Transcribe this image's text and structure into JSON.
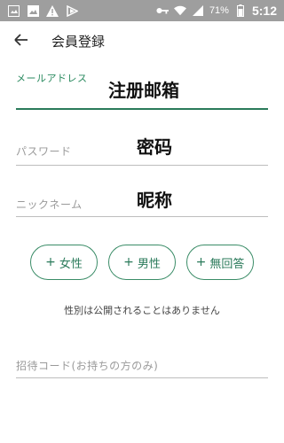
{
  "status_bar": {
    "battery_percent": "71%",
    "time": "5:12",
    "icons": [
      "image-icon",
      "gallery-icon",
      "warning-icon",
      "play-icon",
      "key-icon",
      "wifi-icon",
      "signal-icon",
      "battery-icon"
    ]
  },
  "app_bar": {
    "back_icon": "arrow-left-icon",
    "title": "会員登録"
  },
  "form": {
    "email": {
      "label": "メールアドレス",
      "value": "注册邮箱"
    },
    "password": {
      "placeholder": "パスワード",
      "value": "密码"
    },
    "nickname": {
      "placeholder": "ニックネーム",
      "value": "昵称"
    },
    "gender_buttons": [
      {
        "label": "女性"
      },
      {
        "label": "男性"
      },
      {
        "label": "無回答"
      }
    ],
    "gender_note": "性別は公開されることはありません",
    "invite_code": {
      "placeholder": "招待コード(お持ちの方のみ)"
    }
  },
  "colors": {
    "accent": "#2a7a5a",
    "status_bar_bg": "#9e9e9e"
  }
}
